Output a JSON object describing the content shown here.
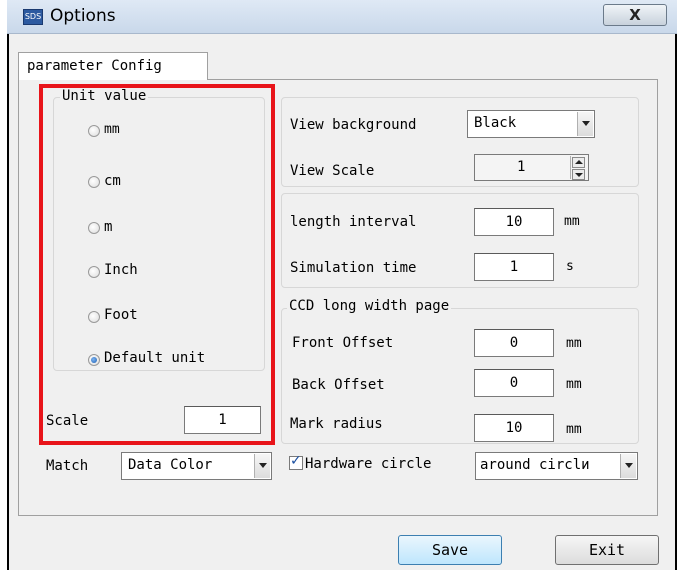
{
  "window": {
    "title": "Options",
    "close_label": "X",
    "icon_text": "SDS"
  },
  "tab": {
    "label": "parameter Config"
  },
  "unit_group": {
    "legend": "Unit value",
    "options": [
      {
        "label": "mm",
        "checked": false
      },
      {
        "label": "cm",
        "checked": false
      },
      {
        "label": "m",
        "checked": false
      },
      {
        "label": "Inch",
        "checked": false
      },
      {
        "label": "Foot",
        "checked": false
      },
      {
        "label": "Default unit",
        "checked": true
      }
    ],
    "scale_label": "Scale",
    "scale_value": "1"
  },
  "match": {
    "label": "Match",
    "value": "Data Color"
  },
  "view": {
    "background_label": "View background",
    "background_value": "Black",
    "scale_label": "View Scale",
    "scale_value": "1"
  },
  "interval": {
    "length_label": "length interval",
    "length_value": "10",
    "length_unit": "mm",
    "sim_label": "Simulation time",
    "sim_value": "1",
    "sim_unit": "s"
  },
  "ccd": {
    "legend": "CCD long width page",
    "front_label": "Front Offset",
    "front_value": "0",
    "front_unit": "mm",
    "back_label": "Back Offset",
    "back_value": "0",
    "back_unit": "mm",
    "mark_label": "Mark radius",
    "mark_value": "10",
    "mark_unit": "mm"
  },
  "hardware": {
    "label": "Hardware circle",
    "checked": true,
    "value": "around circlи"
  },
  "buttons": {
    "save": "Save",
    "exit": "Exit"
  },
  "colors": {
    "highlight": "#e8141a",
    "accent": "#1a5fb4"
  }
}
